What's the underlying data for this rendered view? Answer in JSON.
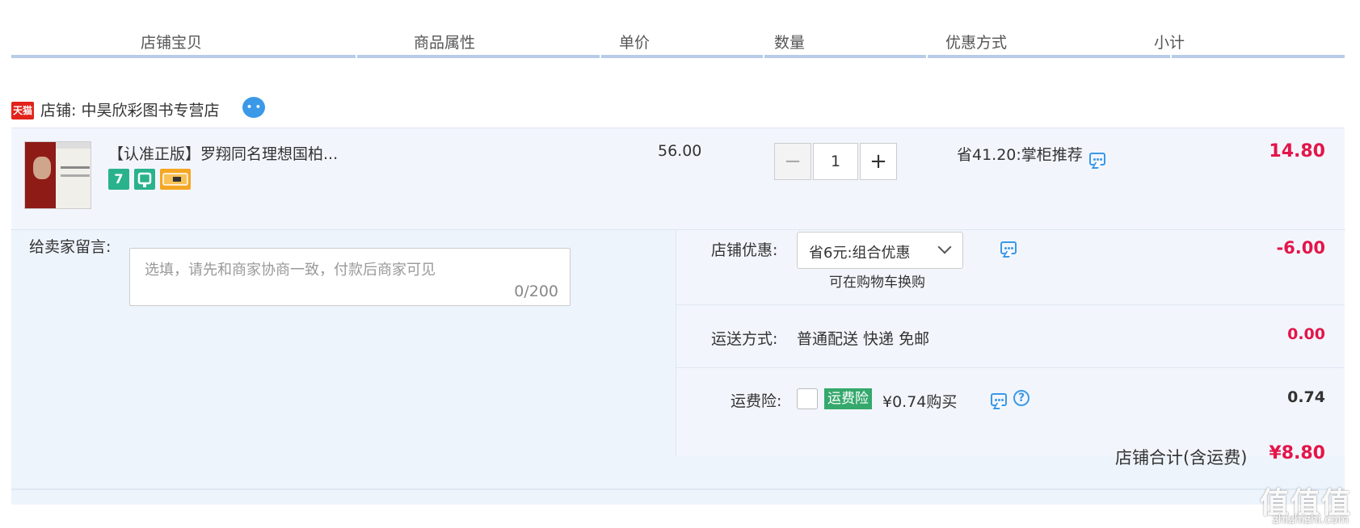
{
  "header": {
    "columns": [
      "店铺宝贝",
      "商品属性",
      "单价",
      "数量",
      "优惠方式",
      "小计"
    ]
  },
  "shop": {
    "platform_badge": "天猫",
    "name": "店铺: 中昊欣彩图书专营店"
  },
  "item": {
    "title": "【认准正版】罗翔同名理想国柏...",
    "badge_seven": "7",
    "unit_price": "56.00",
    "quantity": "1",
    "promo_text": "省41.20:掌柜推荐",
    "subtotal": "14.80"
  },
  "message": {
    "label": "给卖家留言:",
    "placeholder": "选填，请先和商家协商一致，付款后商家可见",
    "count": "0/200"
  },
  "shop_discount": {
    "label": "店铺优惠:",
    "selected": "省6元:组合优惠",
    "note": "可在购物车换购",
    "amount": "-6.00"
  },
  "shipping": {
    "label": "运送方式:",
    "method": "普通配送 快递 免邮",
    "amount": "0.00"
  },
  "insurance": {
    "label": "运费险:",
    "badge": "运费险",
    "price_text": "¥0.74购买",
    "amount": "0.74"
  },
  "total": {
    "label": "店铺合计(含运费)",
    "amount": "¥8.80"
  },
  "watermark": {
    "main": "值值值",
    "sub": "zhizhizhi.com"
  },
  "colors": {
    "accent_red": "#e4154a",
    "link_blue": "#3b99e8",
    "tmall_red": "#e2231a",
    "insurance_green": "#35a86c"
  }
}
